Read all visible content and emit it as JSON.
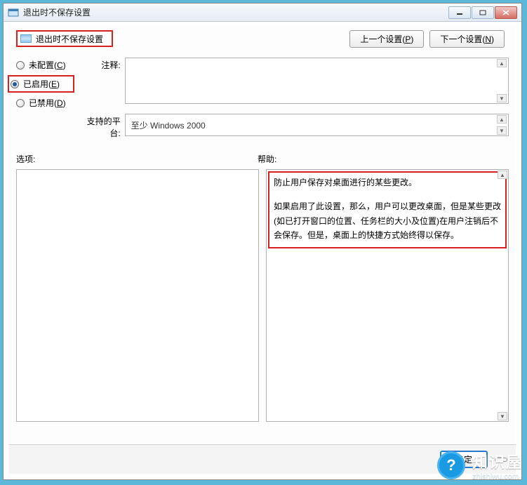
{
  "window": {
    "title": "退出时不保存设置"
  },
  "policy": {
    "name": "退出时不保存设置"
  },
  "nav": {
    "prev": "上一个设置(",
    "prev_key": "P",
    "prev_suffix": ")",
    "next": "下一个设置(",
    "next_key": "N",
    "next_suffix": ")"
  },
  "radios": {
    "not_configured": "未配置(",
    "not_configured_key": "C",
    "not_configured_suffix": ")",
    "enabled": "已启用(",
    "enabled_key": "E",
    "enabled_suffix": ")",
    "disabled": "已禁用(",
    "disabled_key": "D",
    "disabled_suffix": ")",
    "selected": "enabled"
  },
  "labels": {
    "comment": "注释:",
    "supported": "支持的平台:",
    "options": "选项:",
    "help": "帮助:"
  },
  "supported_text": "至少 Windows 2000",
  "help": {
    "p1": "防止用户保存对桌面进行的某些更改。",
    "p2": "如果启用了此设置，那么，用户可以更改桌面，但是某些更改(如已打开窗口的位置、任务栏的大小及位置)在用户注销后不会保存。但是，桌面上的快捷方式始终得以保存。"
  },
  "buttons": {
    "ok": "确定"
  },
  "brand": {
    "cn": "知识屋",
    "en": "zhishiwu.com"
  }
}
